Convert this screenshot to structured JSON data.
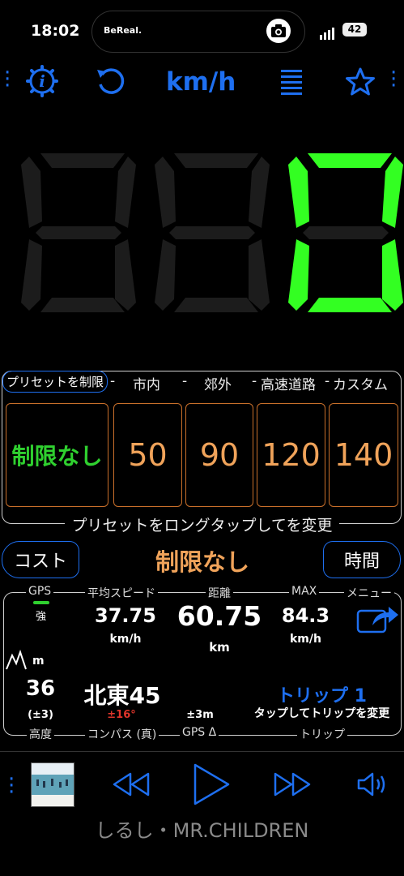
{
  "status_bar": {
    "time": "18:02",
    "live_activity_app": "BeReal.",
    "battery": "42"
  },
  "toolbar": {
    "unit": "km/h"
  },
  "speed": {
    "value": 0
  },
  "presets": {
    "header_chip": "プリセットを制限",
    "columns": [
      "市内",
      "郊外",
      "高速道路",
      "カスタム"
    ],
    "no_limit_label": "制限なし",
    "values": [
      "50",
      "90",
      "120",
      "140"
    ],
    "hint": "プリセットをロングタップしてを変更"
  },
  "limit_row": {
    "left_button": "コスト",
    "status": "制限なし",
    "right_button": "時間"
  },
  "stats": {
    "gps_label": "GPS",
    "gps_strength": "強",
    "avg_speed_label": "平均スピード",
    "avg_speed": "37.75",
    "avg_speed_unit": "km/h",
    "distance_label": "距離",
    "distance": "60.75",
    "distance_unit": "km",
    "max_label": "MAX",
    "max": "84.3",
    "max_unit": "km/h",
    "menu_label": "メニュー",
    "altitude_unit": "m",
    "altitude": "36",
    "altitude_accuracy": "(±3)",
    "altitude_label": "高度",
    "compass": "北東45",
    "compass_deviation": "±16°",
    "compass_label": "コンパス (真)",
    "gps_delta": "±3m",
    "gps_delta_label": "GPS Δ",
    "trip_name": "トリップ 1",
    "trip_hint": "タップしてトリップを変更",
    "trip_label": "トリップ"
  },
  "media": {
    "song": "しるし・MR.CHILDREN"
  },
  "colors": {
    "accent": "#1e6ff0",
    "digit_on": "#33ff22",
    "digit_off": "#1c1c1c",
    "preset_border": "#c86f2a",
    "preset_value": "#f0a35a",
    "no_limit": "#2fd02f",
    "warning": "#e0352b"
  }
}
